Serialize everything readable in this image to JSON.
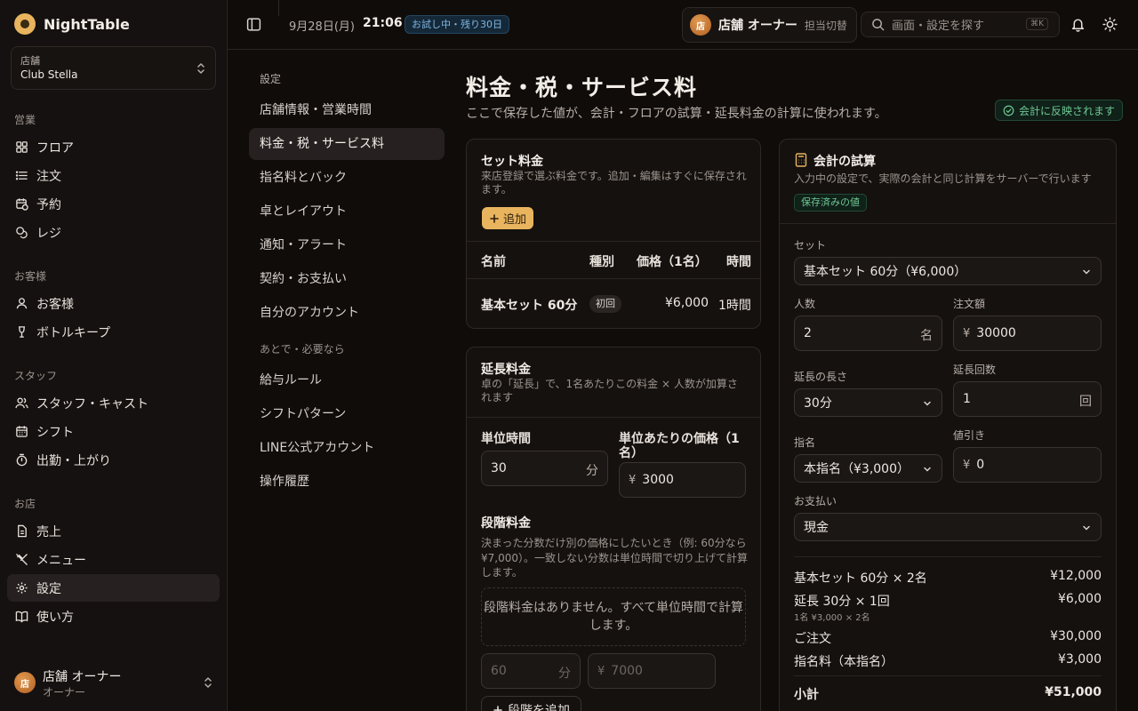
{
  "brand": {
    "name": "NightTable"
  },
  "store": {
    "label": "店舗",
    "name": "Club Stella"
  },
  "sidebar": {
    "sections": [
      {
        "title": "営業",
        "items": [
          {
            "label": "フロア",
            "icon": "grid-icon"
          },
          {
            "label": "注文",
            "icon": "list-icon"
          },
          {
            "label": "予約",
            "icon": "calendar-clock-icon"
          },
          {
            "label": "レジ",
            "icon": "coins-icon"
          }
        ]
      },
      {
        "title": "お客様",
        "items": [
          {
            "label": "お客様",
            "icon": "user-icon"
          },
          {
            "label": "ボトルキープ",
            "icon": "wine-icon"
          }
        ]
      },
      {
        "title": "スタッフ",
        "items": [
          {
            "label": "スタッフ・キャスト",
            "icon": "users-icon"
          },
          {
            "label": "シフト",
            "icon": "calendar-icon"
          },
          {
            "label": "出勤・上がり",
            "icon": "timer-icon"
          }
        ]
      },
      {
        "title": "お店",
        "items": [
          {
            "label": "売上",
            "icon": "document-icon"
          },
          {
            "label": "メニュー",
            "icon": "utensils-icon"
          },
          {
            "label": "設定",
            "icon": "gear-icon",
            "active": true
          },
          {
            "label": "使い方",
            "icon": "book-icon"
          }
        ]
      }
    ]
  },
  "user": {
    "avatar": "店",
    "name": "店舗 オーナー",
    "role": "オーナー"
  },
  "topbar": {
    "date": "9月28日(月)",
    "time": "21:06",
    "trial_badge": "お試し中・残り30日",
    "owner_avatar": "店",
    "owner_name": "店舗 オーナー",
    "switch_label": "担当切替",
    "search_placeholder": "画面・設定を探す",
    "search_shortcut": "⌘K"
  },
  "settings_nav": {
    "heading": "設定",
    "items": [
      {
        "label": "店舗情報・営業時間"
      },
      {
        "label": "料金・税・サービス料",
        "active": true
      },
      {
        "label": "指名料とバック"
      },
      {
        "label": "卓とレイアウト"
      },
      {
        "label": "通知・アラート"
      },
      {
        "label": "契約・お支払い"
      },
      {
        "label": "自分のアカウント"
      }
    ],
    "subheading": "あとで・必要なら",
    "sub_items": [
      {
        "label": "給与ルール"
      },
      {
        "label": "シフトパターン"
      },
      {
        "label": "LINE公式アカウント"
      },
      {
        "label": "操作履歴"
      }
    ]
  },
  "page": {
    "title": "料金・税・サービス料",
    "subtitle": "ここで保存した値が、会計・フロアの試算・延長料金の計算に使われます。",
    "reflect_badge": "会計に反映されます"
  },
  "set_fee": {
    "title": "セット料金",
    "desc": "来店登録で選ぶ料金です。追加・編集はすぐに保存されます。",
    "add_label": "追加",
    "columns": [
      "名前",
      "種別",
      "価格（1名）",
      "時間"
    ],
    "rows": [
      {
        "name": "基本セット 60分",
        "type": "初回",
        "price": "¥6,000",
        "time": "1時間"
      }
    ]
  },
  "extension": {
    "title": "延長料金",
    "desc": "卓の「延長」で、1名あたりこの料金 × 人数が加算されます",
    "unit_time_label": "単位時間",
    "unit_time_value": "30",
    "unit_time_suffix": "分",
    "unit_price_label": "単位あたりの価格（1名）",
    "unit_price_prefix": "¥",
    "unit_price_value": "3000",
    "tier_title": "段階料金",
    "tier_desc": "決まった分数だけ別の価格にしたいとき（例: 60分なら¥7,000）。一致しない分数は単位時間で切り上げて計算します。",
    "tier_empty": "段階料金はありません。すべて単位時間で計算します。",
    "tier_minutes_placeholder": "60",
    "tier_minutes_suffix": "分",
    "tier_price_prefix": "¥",
    "tier_price_placeholder": "7000",
    "tier_add_label": "段階を追加"
  },
  "calc": {
    "title": "会計の試算",
    "desc": "入力中の設定で、実際の会計と同じ計算をサーバーで行います",
    "saved_tag": "保存済みの値",
    "set_label": "セット",
    "set_value": "基本セット 60分（¥6,000）",
    "people_label": "人数",
    "people_value": "2",
    "people_suffix": "名",
    "order_label": "注文額",
    "order_prefix": "¥",
    "order_value": "30000",
    "ext_len_label": "延長の長さ",
    "ext_len_value": "30分",
    "ext_count_label": "延長回数",
    "ext_count_value": "1",
    "ext_count_suffix": "回",
    "nomination_label": "指名",
    "nomination_value": "本指名（¥3,000）",
    "discount_label": "値引き",
    "discount_prefix": "¥",
    "discount_value": "0",
    "payment_label": "お支払い",
    "payment_value": "現金",
    "lines": [
      {
        "label": "基本セット 60分 × 2名",
        "amount": "¥12,000"
      },
      {
        "label": "延長 30分 × 1回",
        "sub": "1名 ¥3,000 × 2名",
        "amount": "¥6,000"
      },
      {
        "label": "ご注文",
        "amount": "¥30,000"
      },
      {
        "label": "指名料（本指名）",
        "amount": "¥3,000"
      }
    ],
    "subtotal_label": "小計",
    "subtotal_amount": "¥51,000"
  }
}
